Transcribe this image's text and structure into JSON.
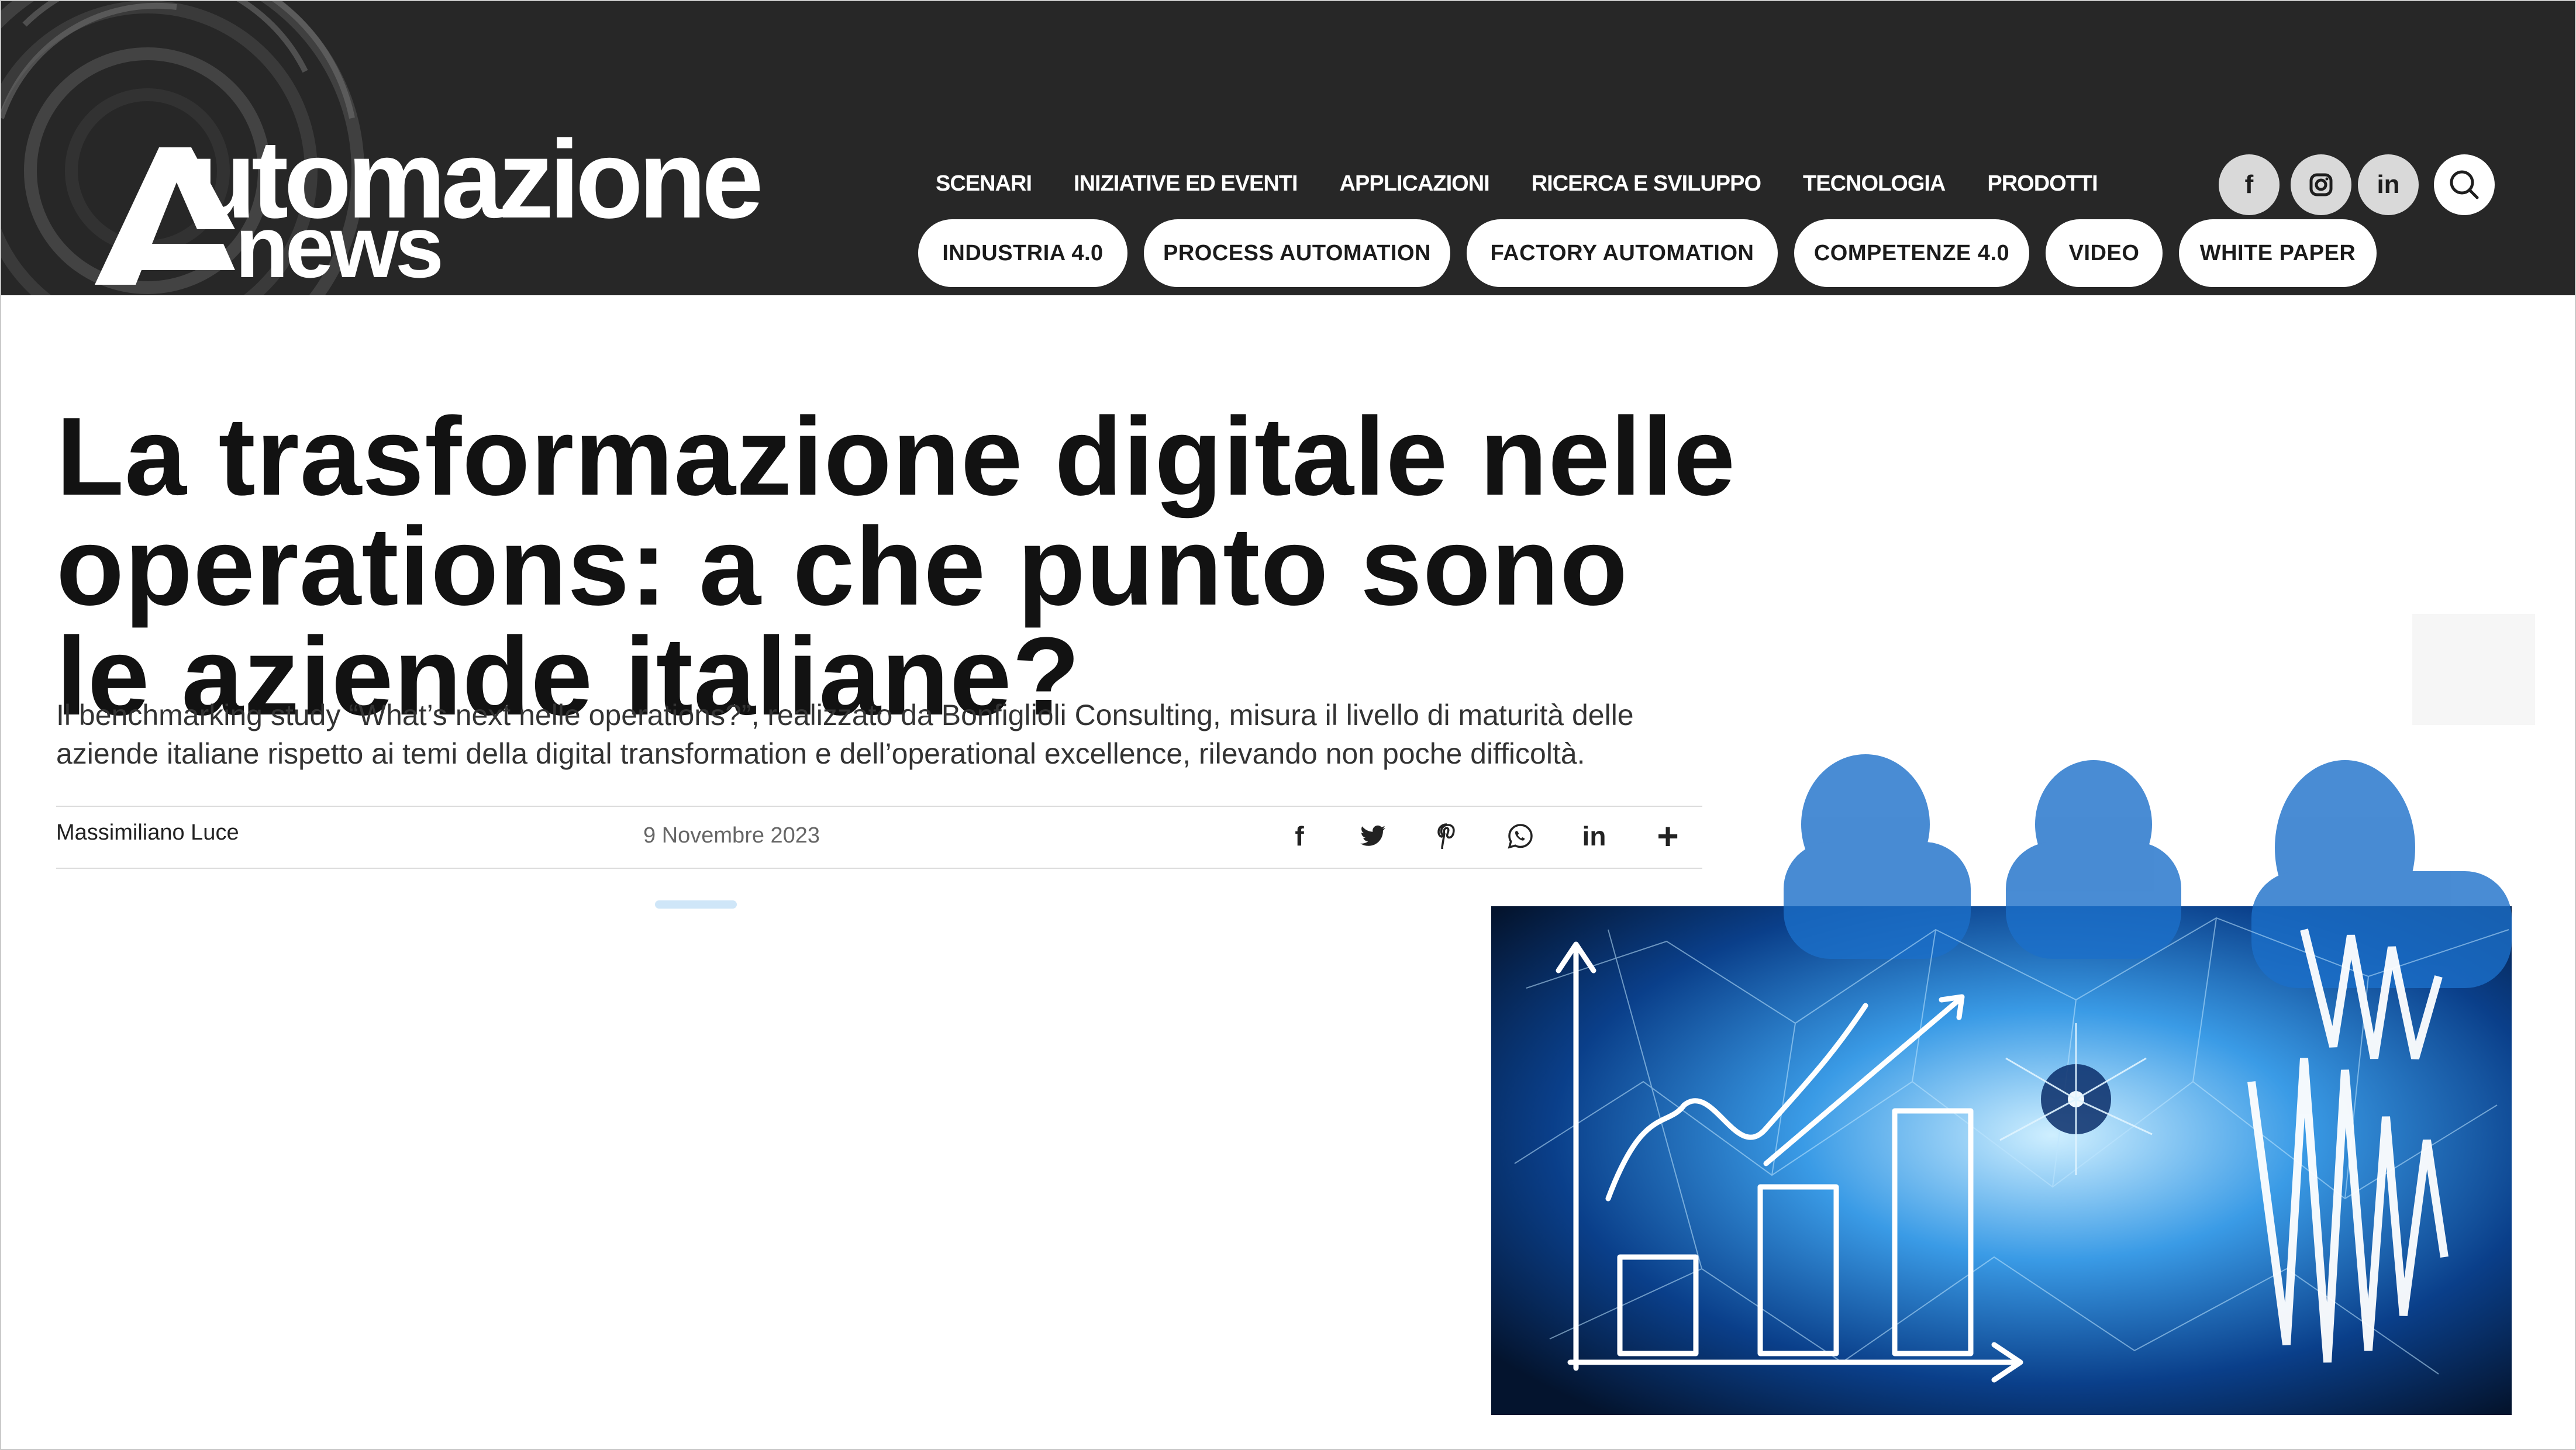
{
  "brand": {
    "name_line1": "utomazione",
    "name_line2": "news",
    "mark": "A"
  },
  "topnav": [
    "SCENARI",
    "INIZIATIVE ED EVENTI",
    "APPLICAZIONI",
    "RICERCA E SVILUPPO",
    "TECNOLOGIA",
    "PRODOTTI"
  ],
  "social": {
    "facebook": "f",
    "instagram": "◎",
    "linkedin": "in"
  },
  "pills": [
    "INDUSTRIA 4.0",
    "PROCESS AUTOMATION",
    "FACTORY AUTOMATION",
    "COMPETENZE 4.0",
    "VIDEO",
    "WHITE PAPER"
  ],
  "article": {
    "title": "La trasformazione digitale nelle operations: a che punto sono le aziende italiane?",
    "lead": "Il benchmarking study “What’s next nelle operations?”, realizzato da Bonfiglioli Consulting, misura il livello di maturità delle aziende italiane rispetto ai temi della digital transformation e dell’operational excellence, rilevando non poche difficoltà.",
    "author": "Massimiliano Luce",
    "date": "9 Novembre 2023"
  },
  "share_icons": [
    "facebook-icon",
    "twitter-icon",
    "pinterest-icon",
    "whatsapp-icon",
    "linkedin-icon",
    "more-icon"
  ],
  "colors": {
    "header_bg": "#272727",
    "accent_blue": "#0a6fd6",
    "title_text": "#121212"
  }
}
